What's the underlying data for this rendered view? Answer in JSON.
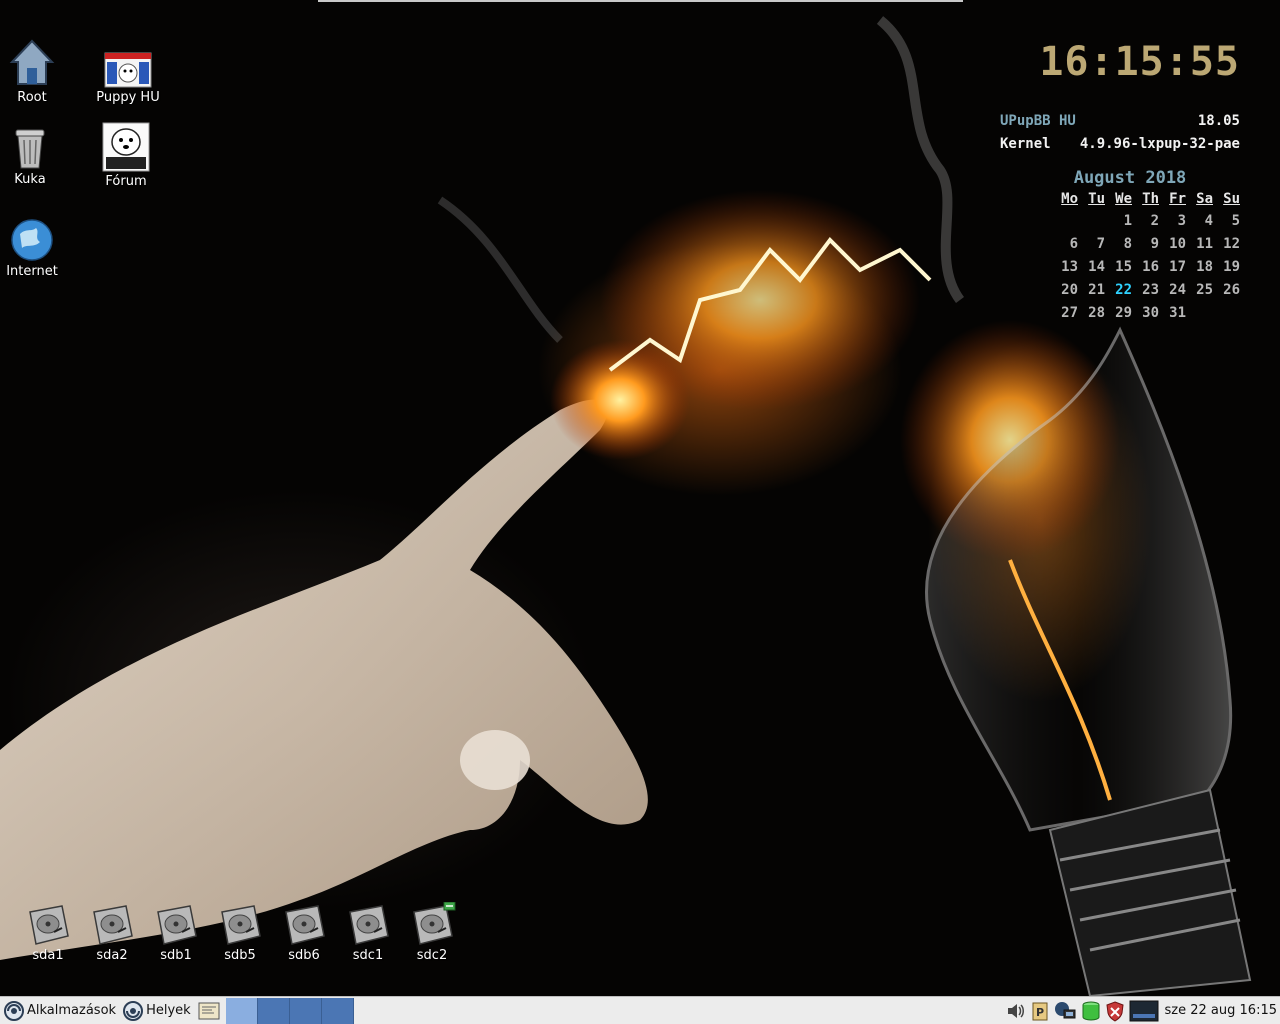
{
  "desktop_icons": [
    {
      "label": "Root",
      "icon": "home-icon"
    },
    {
      "label": "Puppy HU",
      "icon": "puppy-hu-logo-icon"
    },
    {
      "label": "Kuka",
      "icon": "trash-icon"
    },
    {
      "label": "Fórum",
      "icon": "puppy-linux-forum-icon"
    },
    {
      "label": "Internet",
      "icon": "globe-icon"
    }
  ],
  "conky": {
    "clock": "16:15:55",
    "distro_label": "UPupBB HU",
    "distro_version": "18.05",
    "kernel_label": "Kernel",
    "kernel_version": "4.9.96-lxpup-32-pae",
    "calendar": {
      "title": "August  2018",
      "day_headers": [
        "Mo",
        "Tu",
        "We",
        "Th",
        "Fr",
        "Sa",
        "Su"
      ],
      "leading_blanks": 2,
      "days": [
        "1",
        "2",
        "3",
        "4",
        "5",
        "6",
        "7",
        "8",
        "9",
        "10",
        "11",
        "12",
        "13",
        "14",
        "15",
        "16",
        "17",
        "18",
        "19",
        "20",
        "21",
        "22",
        "23",
        "24",
        "25",
        "26",
        "27",
        "28",
        "29",
        "30",
        "31"
      ],
      "today": "22"
    }
  },
  "drives": [
    {
      "label": "sda1"
    },
    {
      "label": "sda2"
    },
    {
      "label": "sdb1"
    },
    {
      "label": "sdb5"
    },
    {
      "label": "sdb6"
    },
    {
      "label": "sdc1"
    },
    {
      "label": "sdc2",
      "mounted": true
    }
  ],
  "taskbar": {
    "apps_menu_label": "Alkalmazások",
    "places_menu_label": "Helyek",
    "workspaces": 4,
    "active_workspace": 1,
    "tray_icons": [
      "volume-icon",
      "clipboard-icon",
      "network-icon",
      "drive-status-icon",
      "firewall-shield-icon",
      "screen-icon"
    ],
    "datetime": "sze 22 aug 16:15"
  },
  "colors": {
    "clock": "#bca874",
    "conky_key": "#7fa7b8",
    "calendar_today": "#2fd2ff",
    "workspace": "#4b76b4",
    "workspace_active": "#8aaee0"
  }
}
